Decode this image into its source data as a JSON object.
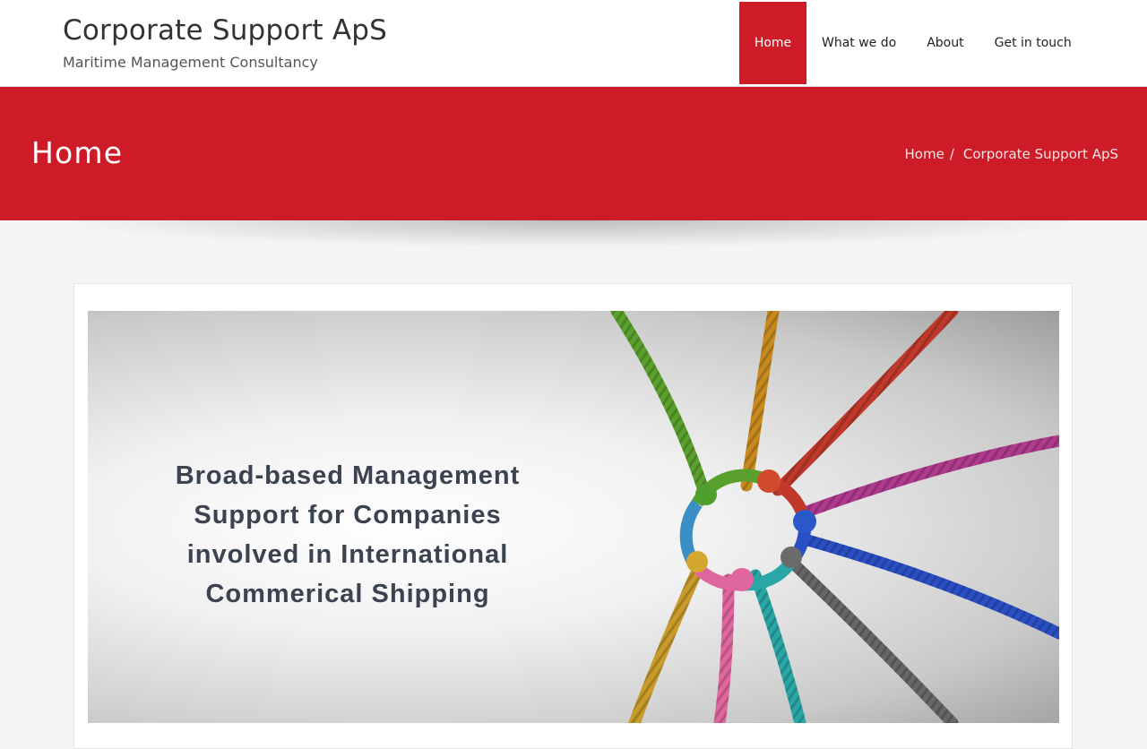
{
  "header": {
    "site_title": "Corporate Support ApS",
    "tagline": "Maritime Management Consultancy",
    "nav": [
      {
        "label": "Home",
        "active": true
      },
      {
        "label": "What we do",
        "active": false
      },
      {
        "label": "About",
        "active": false
      },
      {
        "label": "Get in touch",
        "active": false
      }
    ]
  },
  "banner": {
    "heading": "Home",
    "breadcrumb": {
      "home": "Home",
      "separator": "/",
      "current": "Corporate Support ApS"
    }
  },
  "hero": {
    "lines": [
      "Broad-based Management",
      "Support for Companies",
      "involved in International",
      "Commerical Shipping"
    ],
    "image_subject": "colored ropes knotted together in a ring"
  },
  "colors": {
    "brand_red": "#cd1c28",
    "text_dark": "#333333",
    "hero_text": "#3b4350"
  }
}
